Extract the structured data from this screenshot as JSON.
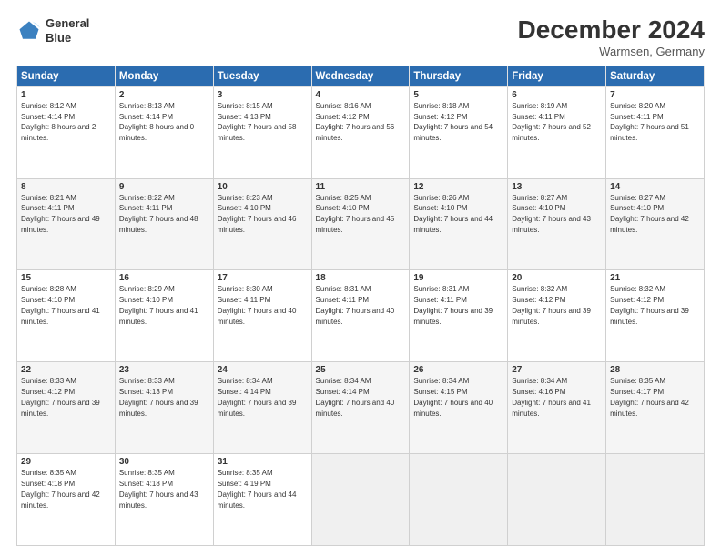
{
  "header": {
    "logo_line1": "General",
    "logo_line2": "Blue",
    "title": "December 2024",
    "subtitle": "Warmsen, Germany"
  },
  "weekdays": [
    "Sunday",
    "Monday",
    "Tuesday",
    "Wednesday",
    "Thursday",
    "Friday",
    "Saturday"
  ],
  "weeks": [
    [
      {
        "day": "1",
        "sunrise": "8:12 AM",
        "sunset": "4:14 PM",
        "daylight": "8 hours and 2 minutes."
      },
      {
        "day": "2",
        "sunrise": "8:13 AM",
        "sunset": "4:14 PM",
        "daylight": "8 hours and 0 minutes."
      },
      {
        "day": "3",
        "sunrise": "8:15 AM",
        "sunset": "4:13 PM",
        "daylight": "7 hours and 58 minutes."
      },
      {
        "day": "4",
        "sunrise": "8:16 AM",
        "sunset": "4:12 PM",
        "daylight": "7 hours and 56 minutes."
      },
      {
        "day": "5",
        "sunrise": "8:18 AM",
        "sunset": "4:12 PM",
        "daylight": "7 hours and 54 minutes."
      },
      {
        "day": "6",
        "sunrise": "8:19 AM",
        "sunset": "4:11 PM",
        "daylight": "7 hours and 52 minutes."
      },
      {
        "day": "7",
        "sunrise": "8:20 AM",
        "sunset": "4:11 PM",
        "daylight": "7 hours and 51 minutes."
      }
    ],
    [
      {
        "day": "8",
        "sunrise": "8:21 AM",
        "sunset": "4:11 PM",
        "daylight": "7 hours and 49 minutes."
      },
      {
        "day": "9",
        "sunrise": "8:22 AM",
        "sunset": "4:11 PM",
        "daylight": "7 hours and 48 minutes."
      },
      {
        "day": "10",
        "sunrise": "8:23 AM",
        "sunset": "4:10 PM",
        "daylight": "7 hours and 46 minutes."
      },
      {
        "day": "11",
        "sunrise": "8:25 AM",
        "sunset": "4:10 PM",
        "daylight": "7 hours and 45 minutes."
      },
      {
        "day": "12",
        "sunrise": "8:26 AM",
        "sunset": "4:10 PM",
        "daylight": "7 hours and 44 minutes."
      },
      {
        "day": "13",
        "sunrise": "8:27 AM",
        "sunset": "4:10 PM",
        "daylight": "7 hours and 43 minutes."
      },
      {
        "day": "14",
        "sunrise": "8:27 AM",
        "sunset": "4:10 PM",
        "daylight": "7 hours and 42 minutes."
      }
    ],
    [
      {
        "day": "15",
        "sunrise": "8:28 AM",
        "sunset": "4:10 PM",
        "daylight": "7 hours and 41 minutes."
      },
      {
        "day": "16",
        "sunrise": "8:29 AM",
        "sunset": "4:10 PM",
        "daylight": "7 hours and 41 minutes."
      },
      {
        "day": "17",
        "sunrise": "8:30 AM",
        "sunset": "4:11 PM",
        "daylight": "7 hours and 40 minutes."
      },
      {
        "day": "18",
        "sunrise": "8:31 AM",
        "sunset": "4:11 PM",
        "daylight": "7 hours and 40 minutes."
      },
      {
        "day": "19",
        "sunrise": "8:31 AM",
        "sunset": "4:11 PM",
        "daylight": "7 hours and 39 minutes."
      },
      {
        "day": "20",
        "sunrise": "8:32 AM",
        "sunset": "4:12 PM",
        "daylight": "7 hours and 39 minutes."
      },
      {
        "day": "21",
        "sunrise": "8:32 AM",
        "sunset": "4:12 PM",
        "daylight": "7 hours and 39 minutes."
      }
    ],
    [
      {
        "day": "22",
        "sunrise": "8:33 AM",
        "sunset": "4:12 PM",
        "daylight": "7 hours and 39 minutes."
      },
      {
        "day": "23",
        "sunrise": "8:33 AM",
        "sunset": "4:13 PM",
        "daylight": "7 hours and 39 minutes."
      },
      {
        "day": "24",
        "sunrise": "8:34 AM",
        "sunset": "4:14 PM",
        "daylight": "7 hours and 39 minutes."
      },
      {
        "day": "25",
        "sunrise": "8:34 AM",
        "sunset": "4:14 PM",
        "daylight": "7 hours and 40 minutes."
      },
      {
        "day": "26",
        "sunrise": "8:34 AM",
        "sunset": "4:15 PM",
        "daylight": "7 hours and 40 minutes."
      },
      {
        "day": "27",
        "sunrise": "8:34 AM",
        "sunset": "4:16 PM",
        "daylight": "7 hours and 41 minutes."
      },
      {
        "day": "28",
        "sunrise": "8:35 AM",
        "sunset": "4:17 PM",
        "daylight": "7 hours and 42 minutes."
      }
    ],
    [
      {
        "day": "29",
        "sunrise": "8:35 AM",
        "sunset": "4:18 PM",
        "daylight": "7 hours and 42 minutes."
      },
      {
        "day": "30",
        "sunrise": "8:35 AM",
        "sunset": "4:18 PM",
        "daylight": "7 hours and 43 minutes."
      },
      {
        "day": "31",
        "sunrise": "8:35 AM",
        "sunset": "4:19 PM",
        "daylight": "7 hours and 44 minutes."
      },
      null,
      null,
      null,
      null
    ]
  ],
  "labels": {
    "sunrise": "Sunrise: ",
    "sunset": "Sunset: ",
    "daylight": "Daylight: "
  }
}
